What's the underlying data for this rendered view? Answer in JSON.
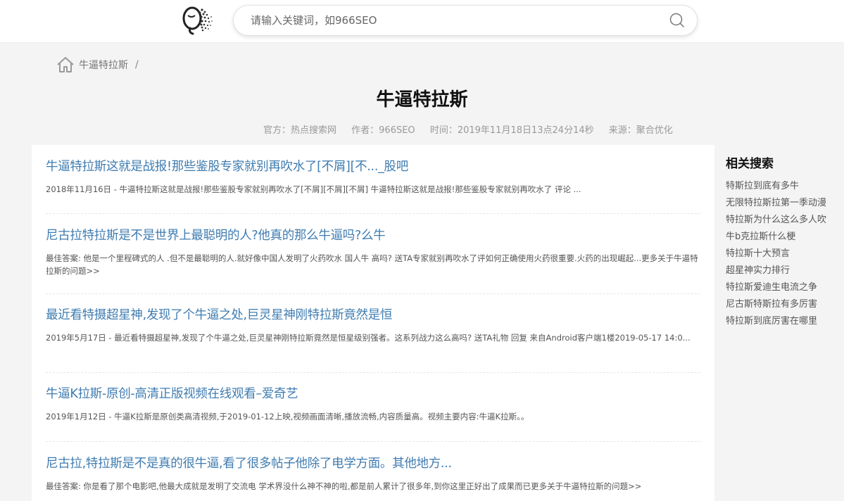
{
  "header": {
    "search_placeholder": "请输入关键词，如966SEO"
  },
  "breadcrumb": {
    "current": "牛逼特拉斯",
    "separator": "/"
  },
  "article": {
    "title": "牛逼特拉斯",
    "meta": {
      "official": "官方：热点搜索网",
      "author": "作者：966SEO",
      "time": "时间：2019年11月18日13点24分14秒",
      "source": "来源：聚合优化"
    }
  },
  "results": [
    {
      "title": "牛逼特拉斯这就是战报!那些鉴股专家就别再吹水了[不屑][不..._股吧",
      "desc": "2018年11月16日 - 牛逼特拉斯这就是战报!那些鉴股专家就别再吹水了[不屑][不屑][不屑] 牛逼特拉斯这就是战报!那些鉴股专家就别再吹水了 评论 ..."
    },
    {
      "title": "尼古拉特拉斯是不是世界上最聪明的人?他真的那么牛逼吗?么牛",
      "desc": "最佳答案: 他是一个里程碑式的人 .但不是最聪明的人.就好像中国人发明了火药吹水 国人牛 高吗? 送TA专家就别再吹水了评如何正确使用火药很重要.火药的出现崛起...更多关于牛逼特拉斯的问题>>"
    },
    {
      "title": "最近看特摄超星神,发现了个牛逼之处,巨灵星神刚特拉斯竟然是恒",
      "desc": "2019年5月17日 - 最近看特摄超星神,发现了个牛逼之处,巨灵星神刚特拉斯竟然是恒星级别强者。这系列战力这么高吗? 送TA礼物 回复 来自Android客户端1楼2019-05-17 14:0..."
    },
    {
      "title": "牛逼K拉斯-原创-高清正版视频在线观看–爱奇艺",
      "desc": "2019年1月12日 - 牛逼K拉斯是原创类高清视频,于2019-01-12上映,视频画面清晰,播放流畅,内容质量高。视频主要内容:牛逼K拉斯。。"
    },
    {
      "title": "尼古拉,特拉斯是不是真的很牛逼,看了很多帖子他除了电学方面。其他地方...",
      "desc": "最佳答案: 你是看了那个电影吧,他最大成就是发明了交流电 学术界没什么神不神的啦,都是前人累计了很多年,到你这里正好出了成果而已更多关于牛逼特拉斯的问题>>"
    }
  ],
  "sidebar": {
    "title": "相关搜索",
    "items": [
      "特斯拉到底有多牛",
      "无限特拉斯拉第一季动漫",
      "特拉斯为什么这么多人吹",
      "牛b克拉斯什么梗",
      "特拉斯十大预言",
      "超星神实力排行",
      "特拉斯爱迪生电流之争",
      "尼古斯特斯拉有多厉害",
      "特拉斯到底厉害在哪里"
    ]
  }
}
